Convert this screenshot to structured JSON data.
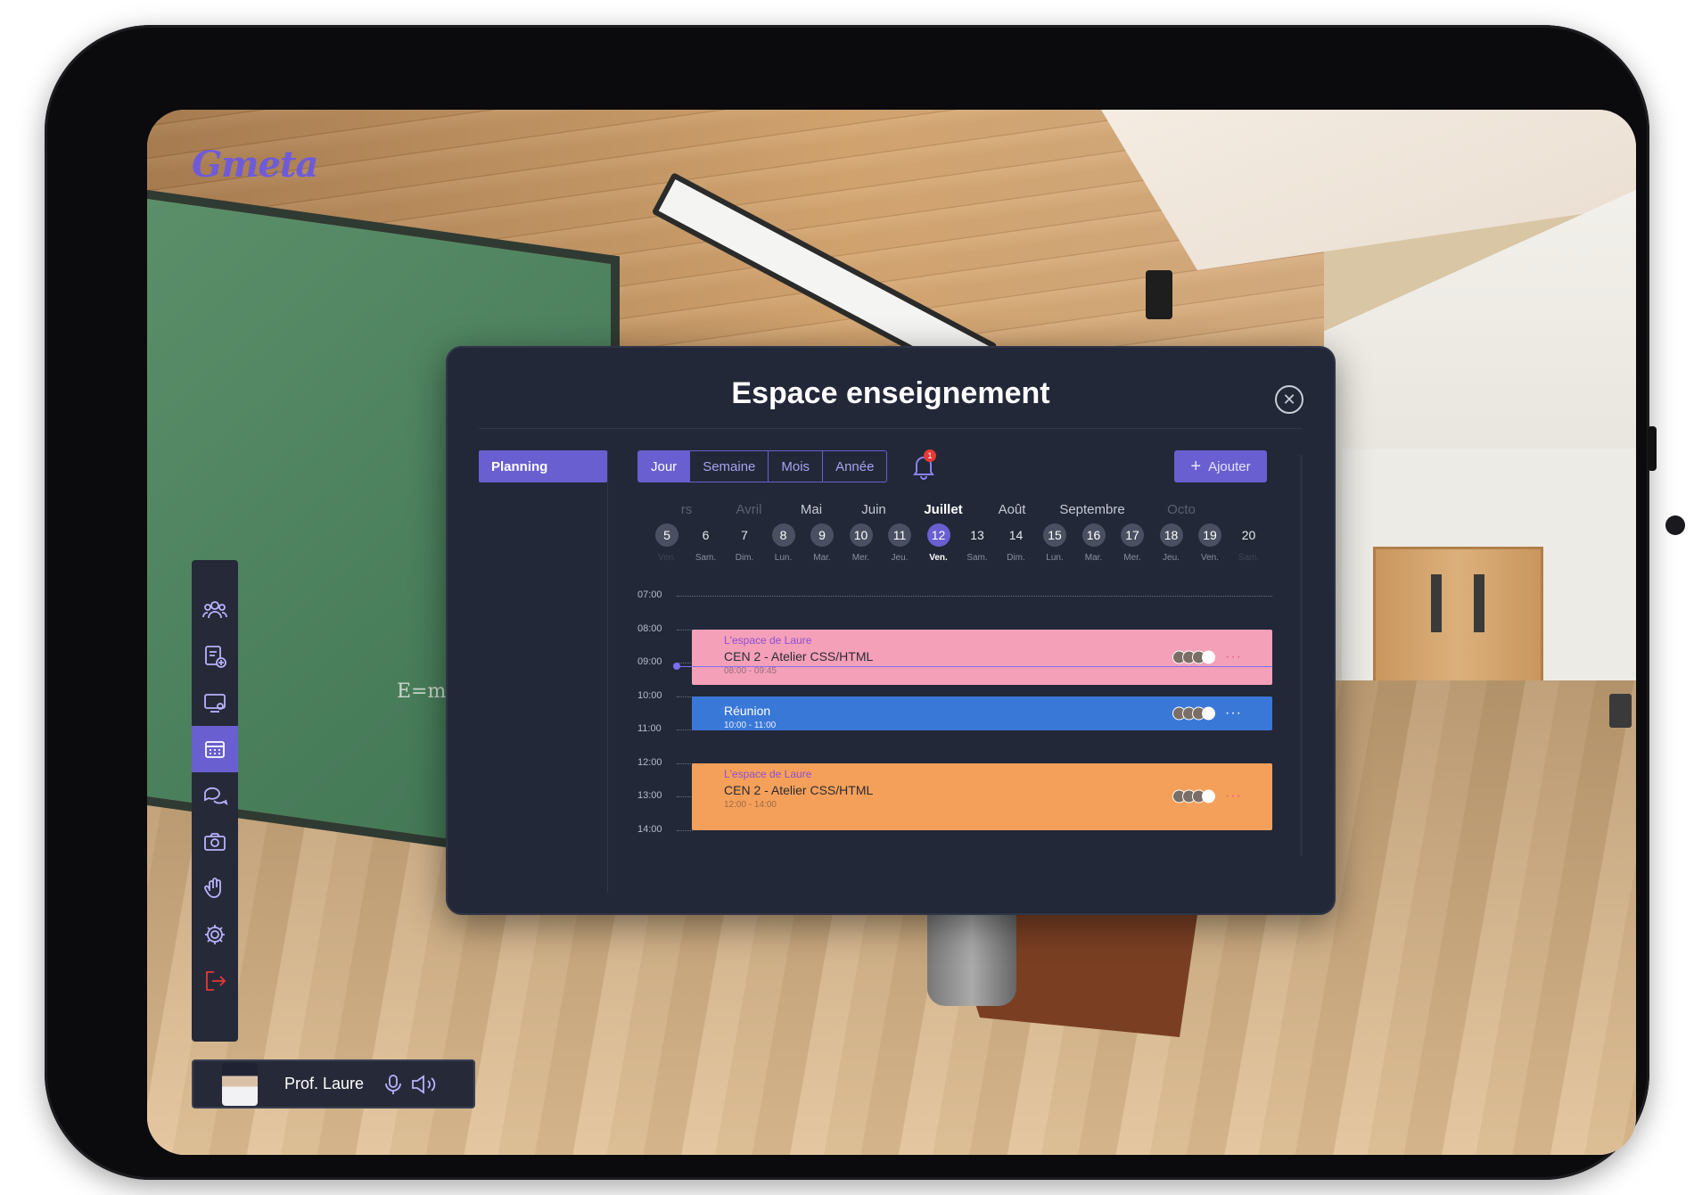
{
  "app": {
    "logo": "Gmeta"
  },
  "scene": {
    "board_formula": "E=m"
  },
  "sidebar": {
    "items": [
      {
        "icon": "users-icon"
      },
      {
        "icon": "add-document-icon"
      },
      {
        "icon": "screen-share-icon"
      },
      {
        "icon": "calendar-icon",
        "active": true
      },
      {
        "icon": "chat-icon"
      },
      {
        "icon": "camera-icon"
      },
      {
        "icon": "hand-raise-icon"
      },
      {
        "icon": "gear-icon"
      },
      {
        "icon": "logout-icon"
      }
    ]
  },
  "user": {
    "name": "Prof. Laure",
    "icons": [
      "microphone-icon",
      "speaker-icon"
    ]
  },
  "modal": {
    "title": "Espace enseignement",
    "close_label": "✕",
    "nav": {
      "planning": "Planning"
    },
    "tabs": [
      "Jour",
      "Semaine",
      "Mois",
      "Année"
    ],
    "active_tab": "Jour",
    "notification_count": "1",
    "add_label": "Ajouter",
    "months": [
      {
        "label": "rs",
        "faded": true
      },
      {
        "label": "Avril",
        "faded": true
      },
      {
        "label": "Mai"
      },
      {
        "label": "Juin"
      },
      {
        "label": "Juillet",
        "current": true
      },
      {
        "label": "Août"
      },
      {
        "label": "Septembre"
      },
      {
        "label": "Octo",
        "faded": true
      }
    ],
    "days": [
      {
        "num": "5",
        "lbl": "Ven."
      },
      {
        "num": "6",
        "lbl": "Sam."
      },
      {
        "num": "7",
        "lbl": "Dim."
      },
      {
        "num": "8",
        "lbl": "Lun."
      },
      {
        "num": "9",
        "lbl": "Mar."
      },
      {
        "num": "10",
        "lbl": "Mer."
      },
      {
        "num": "11",
        "lbl": "Jeu."
      },
      {
        "num": "12",
        "lbl": "Ven.",
        "selected": true
      },
      {
        "num": "13",
        "lbl": "Sam."
      },
      {
        "num": "14",
        "lbl": "Dim."
      },
      {
        "num": "15",
        "lbl": "Lun."
      },
      {
        "num": "16",
        "lbl": "Mar."
      },
      {
        "num": "17",
        "lbl": "Mer."
      },
      {
        "num": "18",
        "lbl": "Jeu."
      },
      {
        "num": "19",
        "lbl": "Ven."
      },
      {
        "num": "20",
        "lbl": "Sam."
      }
    ],
    "hours": [
      "07:00",
      "08:00",
      "09:00",
      "10:00",
      "11:00",
      "12:00",
      "13:00",
      "14:00"
    ],
    "events": [
      {
        "organizer": "L'espace de Laure",
        "title": "CEN 2 - Atelier CSS/HTML",
        "time": "08:00 - 09:45",
        "color": "#f4a0b9",
        "accent": "#8e4fd0",
        "start": 8.0,
        "end": 9.67
      },
      {
        "organizer": "",
        "title": "Réunion",
        "time": "10:00 - 11:00",
        "color": "#3a78d8",
        "accent": "#ffffff",
        "start": 10.0,
        "end": 11.0
      },
      {
        "organizer": "L'espace de Laure",
        "title": "CEN 2 - Atelier CSS/HTML",
        "time": "12:00 - 14:00",
        "color": "#f5a05a",
        "accent": "#8e4fd0",
        "start": 12.0,
        "end": 14.0
      }
    ],
    "now": 9.1
  },
  "colors": {
    "accent": "#6a5fd0",
    "modal_bg": "#222838",
    "danger": "#e53935"
  }
}
